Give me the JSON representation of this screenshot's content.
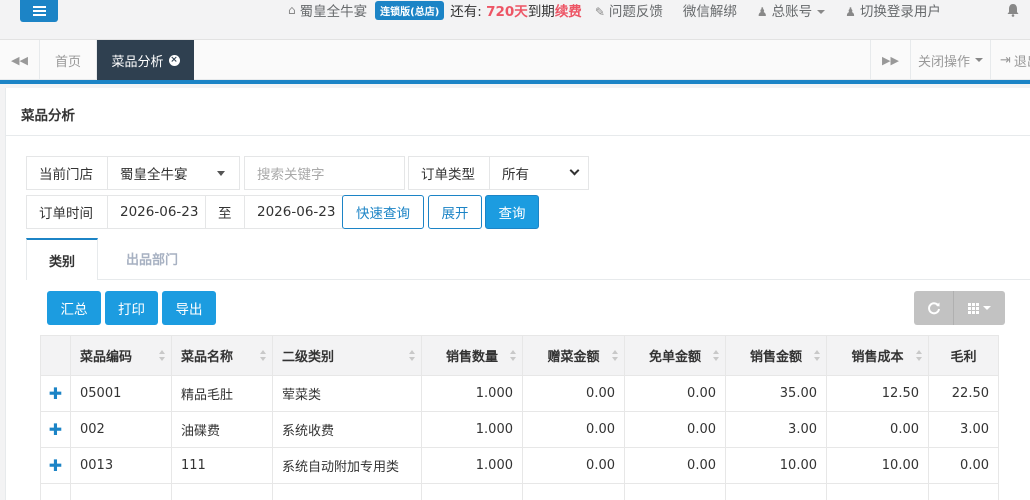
{
  "topbar": {
    "store_name": "蜀皇全牛宴",
    "edition_badge": "连锁版(总店)",
    "remain_prefix": "还有:",
    "remain_days": "720天",
    "remain_suffix": "到期",
    "renew": "续费",
    "feedback": "问题反馈",
    "wechat": "微信解绑",
    "account": "总账号",
    "switch_user": "切换登录用户"
  },
  "tabs": {
    "home": "首页",
    "active": "菜品分析",
    "close_ops": "关闭操作",
    "logout": "退出"
  },
  "panel": {
    "title": "菜品分析"
  },
  "filters": {
    "store_label": "当前门店",
    "store_value": "蜀皇全牛宴",
    "search_placeholder": "搜索关键字",
    "order_type_label": "订单类型",
    "order_type_value": "所有",
    "order_time_label": "订单时间",
    "date_from": "2026-06-23",
    "to_label": "至",
    "date_to": "2026-06-23",
    "quick_query": "快速查询",
    "expand": "展开",
    "query": "查询"
  },
  "subtabs": {
    "category": "类别",
    "department": "出品部门"
  },
  "toolbar": {
    "summary": "汇总",
    "print": "打印",
    "export": "导出"
  },
  "table": {
    "headers": [
      "菜品编码",
      "菜品名称",
      "二级类别",
      "销售数量",
      "赠菜金额",
      "免单金额",
      "销售金额",
      "销售成本",
      "毛利"
    ],
    "rows": [
      [
        "05001",
        "精品毛肚",
        "荤菜类",
        "1.000",
        "0.00",
        "0.00",
        "35.00",
        "12.50",
        "22.50"
      ],
      [
        "002",
        "油碟费",
        "系统收费",
        "1.000",
        "0.00",
        "0.00",
        "3.00",
        "0.00",
        "3.00"
      ],
      [
        "0013",
        "111",
        "系统自动附加专用类",
        "1.000",
        "0.00",
        "0.00",
        "10.00",
        "10.00",
        "0.00"
      ]
    ]
  },
  "colors": {
    "primary": "#1c84c6",
    "button": "#1c9ce0",
    "tab_active": "#2f4050",
    "alert": "#ed5565"
  }
}
